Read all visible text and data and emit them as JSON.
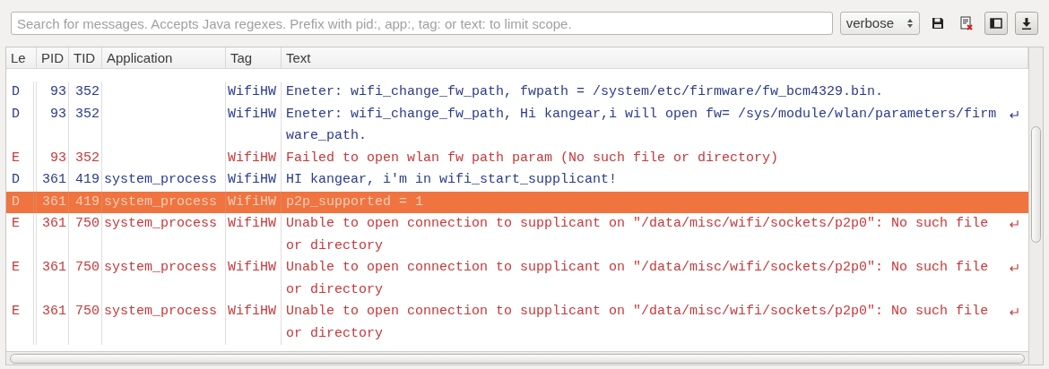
{
  "toolbar": {
    "search": {
      "placeholder": "Search for messages. Accepts Java regexes. Prefix with pid:, app:, tag: or text: to limit scope."
    },
    "log_level": "verbose"
  },
  "table": {
    "columns": [
      "Le",
      "PID",
      "TID",
      "Application",
      "Tag",
      "Text"
    ],
    "rows": [
      {
        "kind": "debug",
        "level": "D",
        "pid": "93",
        "tid": "352",
        "application": "",
        "tag": "WifiHW",
        "lines": [
          "Eneter: wifi_change_fw_path, fwpath = /system/etc/firmware/fw_bcm4329.bin."
        ],
        "selected": false
      },
      {
        "kind": "debug",
        "level": "D",
        "pid": "93",
        "tid": "352",
        "application": "",
        "tag": "WifiHW",
        "lines": [
          "Eneter: wifi_change_fw_path, Hi kangear,i will open fw= /sys/module/wlan/parameters/firm",
          "ware_path."
        ],
        "selected": false
      },
      {
        "kind": "error",
        "level": "E",
        "pid": "93",
        "tid": "352",
        "application": "",
        "tag": "WifiHW",
        "lines": [
          "Failed to open wlan fw path param (No such file or directory)"
        ],
        "selected": false
      },
      {
        "kind": "debug",
        "level": "D",
        "pid": "361",
        "tid": "419",
        "application": "system_process",
        "tag": "WifiHW",
        "lines": [
          "HI kangear, i'm in wifi_start_supplicant!"
        ],
        "selected": false
      },
      {
        "kind": "debug",
        "level": "D",
        "pid": "361",
        "tid": "419",
        "application": "system_process",
        "tag": "WifiHW",
        "lines": [
          "p2p_supported = 1"
        ],
        "selected": true
      },
      {
        "kind": "error",
        "level": "E",
        "pid": "361",
        "tid": "750",
        "application": "system_process",
        "tag": "WifiHW",
        "lines": [
          "Unable to open connection to supplicant on \"/data/misc/wifi/sockets/p2p0\": No such file",
          "or directory"
        ],
        "selected": false
      },
      {
        "kind": "error",
        "level": "E",
        "pid": "361",
        "tid": "750",
        "application": "system_process",
        "tag": "WifiHW",
        "lines": [
          "Unable to open connection to supplicant on \"/data/misc/wifi/sockets/p2p0\": No such file",
          "or directory"
        ],
        "selected": false
      },
      {
        "kind": "error",
        "level": "E",
        "pid": "361",
        "tid": "750",
        "application": "system_process",
        "tag": "WifiHW",
        "lines": [
          "Unable to open connection to supplicant on \"/data/misc/wifi/sockets/p2p0\": No such file",
          "or directory"
        ],
        "selected": false
      }
    ]
  }
}
